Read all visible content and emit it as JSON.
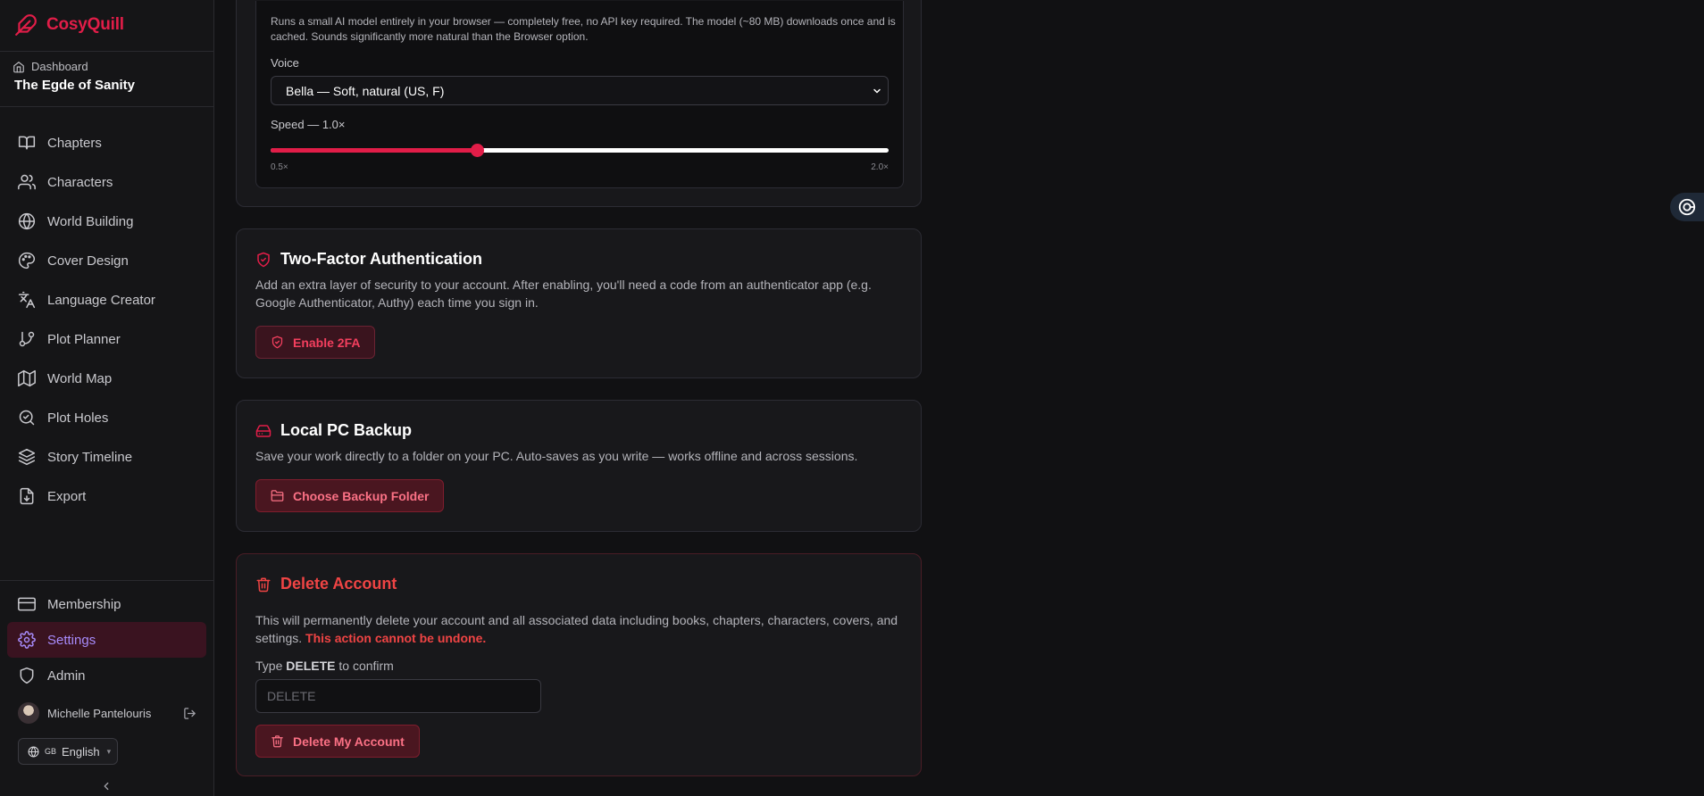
{
  "brand": {
    "name": "CosyQuill"
  },
  "breadcrumb": {
    "label": "Dashboard"
  },
  "project": {
    "title": "The Egde of Sanity"
  },
  "nav": {
    "items": [
      {
        "label": "Chapters"
      },
      {
        "label": "Characters"
      },
      {
        "label": "World Building"
      },
      {
        "label": "Cover Design"
      },
      {
        "label": "Language Creator"
      },
      {
        "label": "Plot Planner"
      },
      {
        "label": "World Map"
      },
      {
        "label": "Plot Holes"
      },
      {
        "label": "Story Timeline"
      },
      {
        "label": "Export"
      }
    ],
    "bottom": [
      {
        "label": "Membership"
      },
      {
        "label": "Settings",
        "active": true
      },
      {
        "label": "Admin"
      }
    ]
  },
  "user": {
    "name": "Michelle Pantelouris"
  },
  "language": {
    "code": "GB",
    "label": "English"
  },
  "tts": {
    "description": "Runs a small AI model entirely in your browser — completely free, no API key required. The model (~80 MB) downloads once and is cached. Sounds significantly more natural than the Browser option.",
    "voice_label": "Voice",
    "voice_selected": "Bella — Soft, natural (US, F)",
    "speed_label": "Speed — 1.0×",
    "speed_min_label": "0.5×",
    "speed_max_label": "2.0×",
    "speed_min": 0.5,
    "speed_max": 2.0,
    "speed_value": 1.0
  },
  "two_factor": {
    "title": "Two-Factor Authentication",
    "description": "Add an extra layer of security to your account. After enabling, you'll need a code from an authenticator app (e.g. Google Authenticator, Authy) each time you sign in.",
    "button": "Enable 2FA"
  },
  "backup": {
    "title": "Local PC Backup",
    "description": "Save your work directly to a folder on your PC. Auto-saves as you write — works offline and across sessions.",
    "button": "Choose Backup Folder"
  },
  "delete_account": {
    "title": "Delete Account",
    "description": "This will permanently delete your account and all associated data including books, chapters, characters, covers, and settings.",
    "warning": "This action cannot be undone.",
    "confirm_prefix": "Type",
    "confirm_word": "DELETE",
    "confirm_suffix": "to confirm",
    "input_placeholder": "DELETE",
    "button": "Delete My Account"
  },
  "colors": {
    "accent": "#e11d48",
    "active_text": "#a78bfa",
    "danger": "#ef4444",
    "background": "#111113"
  }
}
